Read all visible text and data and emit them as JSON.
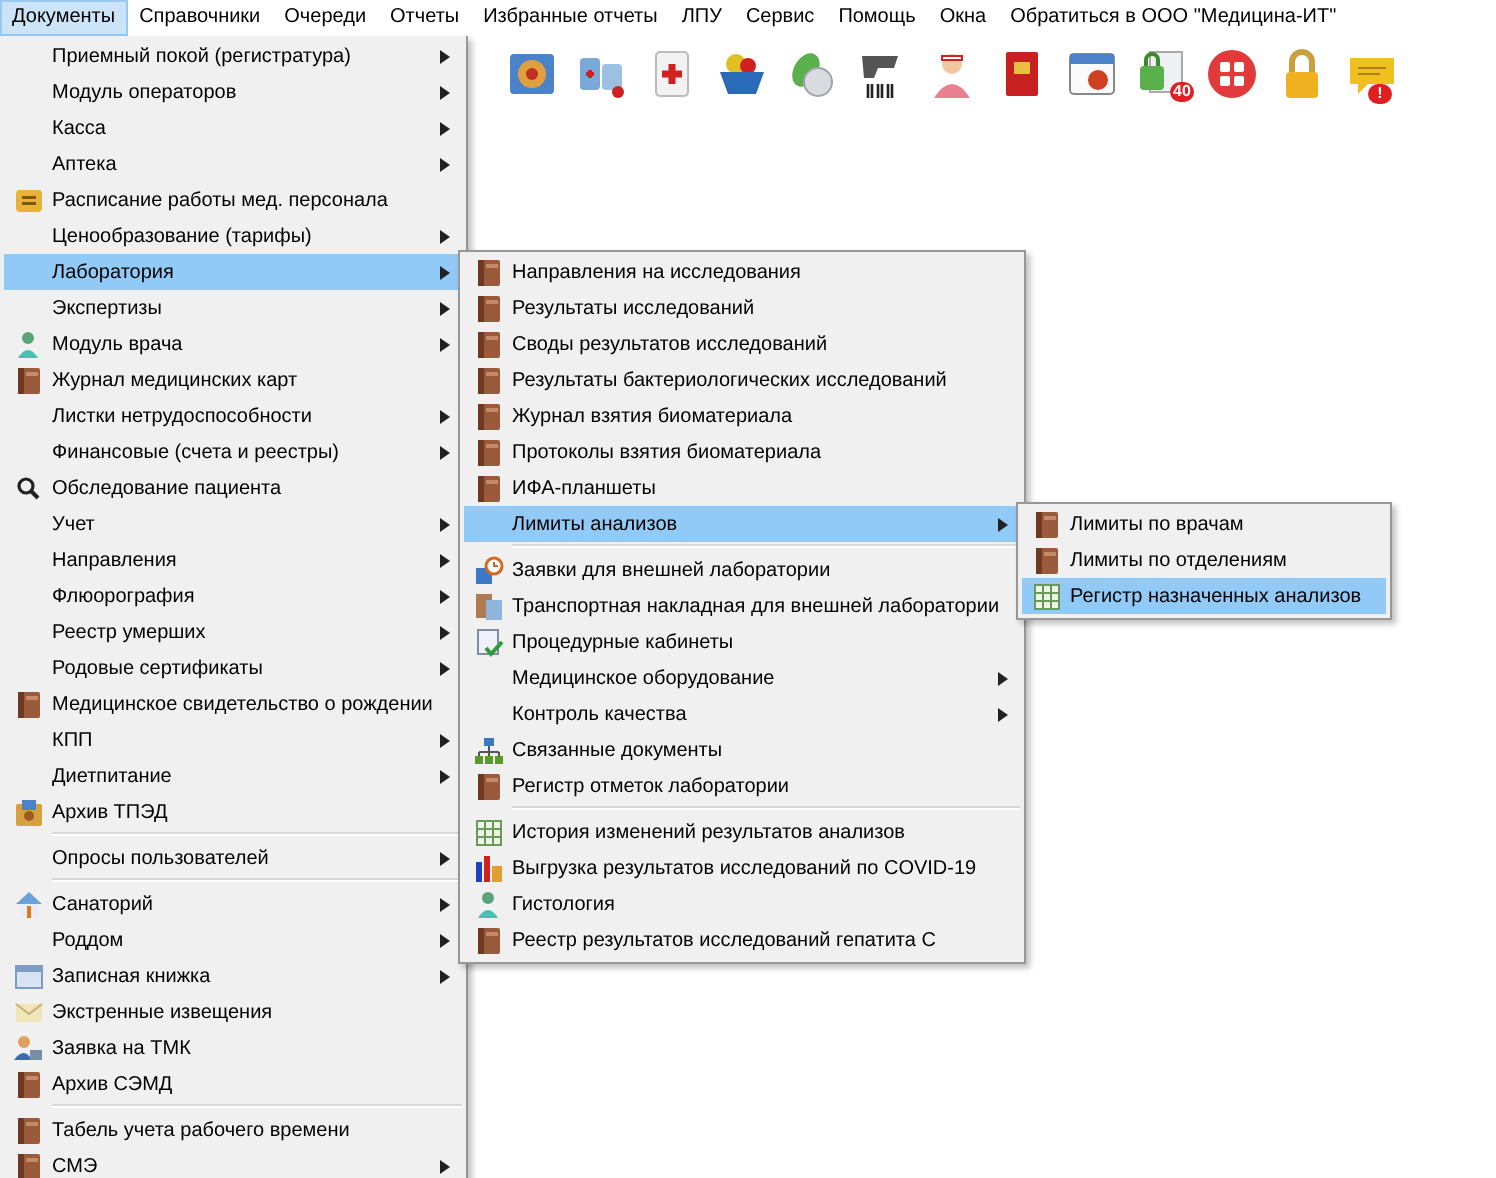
{
  "menubar": [
    {
      "label": "Документы",
      "selected": true
    },
    {
      "label": "Справочники",
      "selected": false
    },
    {
      "label": "Очереди",
      "selected": false
    },
    {
      "label": "Отчеты",
      "selected": false
    },
    {
      "label": "Избранные отчеты",
      "selected": false
    },
    {
      "label": "ЛПУ",
      "selected": false
    },
    {
      "label": "Сервис",
      "selected": false
    },
    {
      "label": "Помощь",
      "selected": false
    },
    {
      "label": "Окна",
      "selected": false
    },
    {
      "label": "Обратиться в ООО \"Медицина-ИТ\"",
      "selected": false
    }
  ],
  "toolbar": [
    {
      "kind": "map"
    },
    {
      "kind": "medicine"
    },
    {
      "kind": "firstaid"
    },
    {
      "kind": "basket"
    },
    {
      "kind": "pills"
    },
    {
      "kind": "scanner"
    },
    {
      "kind": "nurse"
    },
    {
      "kind": "redbook"
    },
    {
      "kind": "calendar"
    },
    {
      "kind": "lockdoc",
      "badge": "40"
    },
    {
      "kind": "apps"
    },
    {
      "kind": "lock"
    },
    {
      "kind": "chat",
      "badge": "!"
    }
  ],
  "menu": {
    "groups": [
      [
        {
          "label": "Приемный покой (регистратура)",
          "submenu": true,
          "selected": false
        },
        {
          "label": "Модуль операторов",
          "submenu": true,
          "selected": false
        },
        {
          "label": "Касса",
          "submenu": true,
          "selected": false
        },
        {
          "label": "Аптека",
          "submenu": true,
          "selected": false
        },
        {
          "label": "Расписание работы мед. персонала",
          "kind": "schedule",
          "submenu": false,
          "selected": false
        },
        {
          "label": "Ценообразование (тарифы)",
          "submenu": true,
          "selected": false
        },
        {
          "label": "Лаборатория",
          "submenu": true,
          "selected": true
        },
        {
          "label": "Экспертизы",
          "submenu": true,
          "selected": false
        },
        {
          "label": "Модуль врача",
          "kind": "doctor",
          "submenu": true,
          "selected": false
        },
        {
          "label": "Журнал медицинских карт",
          "kind": "book",
          "submenu": false,
          "selected": false
        },
        {
          "label": "Листки нетрудоспособности",
          "submenu": true,
          "selected": false
        },
        {
          "label": "Финансовые (счета и реестры)",
          "submenu": true,
          "selected": false
        },
        {
          "label": "Обследование пациента",
          "kind": "search",
          "submenu": false,
          "selected": false
        },
        {
          "label": "Учет",
          "submenu": true,
          "selected": false
        },
        {
          "label": "Направления",
          "submenu": true,
          "selected": false
        },
        {
          "label": "Флюорография",
          "submenu": true,
          "selected": false
        },
        {
          "label": "Реестр умерших",
          "submenu": true,
          "selected": false
        },
        {
          "label": "Родовые сертификаты",
          "submenu": true,
          "selected": false
        },
        {
          "label": "Медицинское свидетельство о рождении",
          "kind": "book",
          "submenu": false,
          "selected": false
        },
        {
          "label": "КПП",
          "submenu": true,
          "selected": false
        },
        {
          "label": "Диетпитание",
          "submenu": true,
          "selected": false
        },
        {
          "label": "Архив ТПЭД",
          "kind": "archive",
          "submenu": false,
          "selected": false
        }
      ],
      [
        {
          "label": "Опросы пользователей",
          "submenu": true,
          "selected": false
        }
      ],
      [
        {
          "label": "Санаторий",
          "kind": "house",
          "submenu": true,
          "selected": false
        },
        {
          "label": "Роддом",
          "submenu": true,
          "selected": false
        },
        {
          "label": "Записная книжка",
          "kind": "notebook",
          "submenu": true,
          "selected": false
        },
        {
          "label": "Экстренные извещения",
          "kind": "notice",
          "submenu": false,
          "selected": false
        },
        {
          "label": "Заявка на ТМК",
          "kind": "tmk",
          "submenu": false,
          "selected": false
        },
        {
          "label": "Архив СЭМД",
          "kind": "book",
          "submenu": false,
          "selected": false
        }
      ],
      [
        {
          "label": "Табель учета рабочего времени",
          "kind": "book",
          "submenu": false,
          "selected": false
        },
        {
          "label": "СМЭ",
          "kind": "book",
          "submenu": true,
          "selected": false
        }
      ]
    ]
  },
  "submenu": {
    "groups": [
      [
        {
          "label": "Направления на исследования",
          "kind": "book",
          "submenu": false,
          "selected": false
        },
        {
          "label": "Результаты исследований",
          "kind": "book",
          "submenu": false,
          "selected": false
        },
        {
          "label": "Своды результатов исследований",
          "kind": "book",
          "submenu": false,
          "selected": false
        },
        {
          "label": "Результаты бактериологических исследований",
          "kind": "book",
          "submenu": false,
          "selected": false
        },
        {
          "label": "Журнал взятия биоматериала",
          "kind": "book",
          "submenu": false,
          "selected": false
        },
        {
          "label": "Протоколы взятия биоматериала",
          "kind": "book",
          "submenu": false,
          "selected": false
        },
        {
          "label": "ИФА-планшеты",
          "kind": "book",
          "submenu": false,
          "selected": false
        },
        {
          "label": "Лимиты анализов",
          "submenu": true,
          "selected": true
        }
      ],
      [
        {
          "label": "Заявки для внешней лаборатории",
          "kind": "request",
          "submenu": false,
          "selected": false
        },
        {
          "label": "Транспортная накладная для внешней лаборатории",
          "kind": "waybill",
          "submenu": false,
          "selected": false
        },
        {
          "label": "Процедурные кабинеты",
          "kind": "procedure",
          "submenu": false,
          "selected": false
        },
        {
          "label": "Медицинское оборудование",
          "submenu": true,
          "selected": false
        },
        {
          "label": "Контроль качества",
          "submenu": true,
          "selected": false
        },
        {
          "label": "Связанные документы",
          "kind": "network",
          "submenu": false,
          "selected": false
        },
        {
          "label": "Регистр отметок лаборатории",
          "kind": "book",
          "submenu": false,
          "selected": false
        }
      ],
      [
        {
          "label": "История изменений результатов анализов",
          "kind": "grid",
          "submenu": false,
          "selected": false
        },
        {
          "label": "Выгрузка результатов исследований по COVID-19",
          "kind": "covid",
          "submenu": false,
          "selected": false
        },
        {
          "label": "Гистология",
          "kind": "doctor",
          "submenu": false,
          "selected": false
        },
        {
          "label": "Реестр результатов исследований гепатита С",
          "kind": "book",
          "submenu": false,
          "selected": false
        }
      ]
    ]
  },
  "submenu2": {
    "groups": [
      [
        {
          "label": "Лимиты по врачам",
          "kind": "book",
          "submenu": false,
          "selected": false
        },
        {
          "label": "Лимиты по отделениям",
          "kind": "book",
          "submenu": false,
          "selected": false
        },
        {
          "label": "Регистр назначенных анализов",
          "kind": "grid",
          "submenu": false,
          "selected": true
        }
      ]
    ]
  }
}
